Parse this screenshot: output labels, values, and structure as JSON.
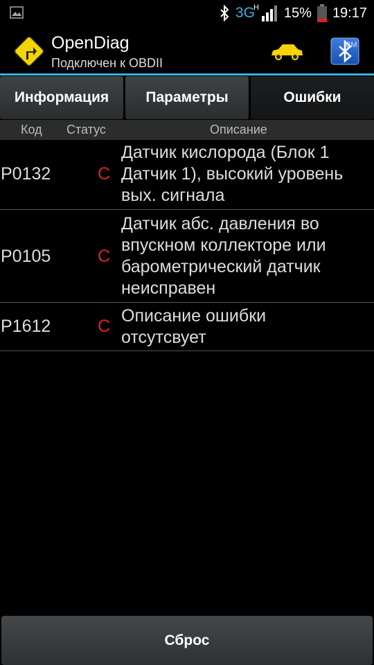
{
  "status_bar": {
    "network": "3G",
    "network_sub": "H",
    "battery": "15%",
    "time": "19:17",
    "icons": [
      "image-icon",
      "bluetooth-icon",
      "signal-icon",
      "battery-icon"
    ]
  },
  "app": {
    "title": "OpenDiag",
    "subtitle": "Подключен к OBDII",
    "bt_label": "BM",
    "colors": {
      "accent": "#33b5e5",
      "status": "#e02020",
      "car": "#f5d400"
    }
  },
  "tabs": [
    {
      "label": "Информация",
      "active": false
    },
    {
      "label": "Параметры",
      "active": false
    },
    {
      "label": "Ошибки",
      "active": true
    }
  ],
  "table": {
    "headers": {
      "code": "Код",
      "status": "Статус",
      "description": "Описание"
    },
    "rows": [
      {
        "code": "P0132",
        "status": "C",
        "description_lines": [
          "Датчик кислорода (Блок 1",
          "Датчик 1), высокий уровень",
          "вых. сигнала"
        ]
      },
      {
        "code": "P0105",
        "status": "C",
        "description_lines": [
          "Датчик абс. давления во",
          "впускном коллекторе или",
          "барометрический датчик",
          "неисправен"
        ]
      },
      {
        "code": "P1612",
        "status": "C",
        "description_lines": [
          "Описание ошибки",
          "отсутсвует"
        ]
      }
    ]
  },
  "reset_button": {
    "label": "Сброс"
  }
}
